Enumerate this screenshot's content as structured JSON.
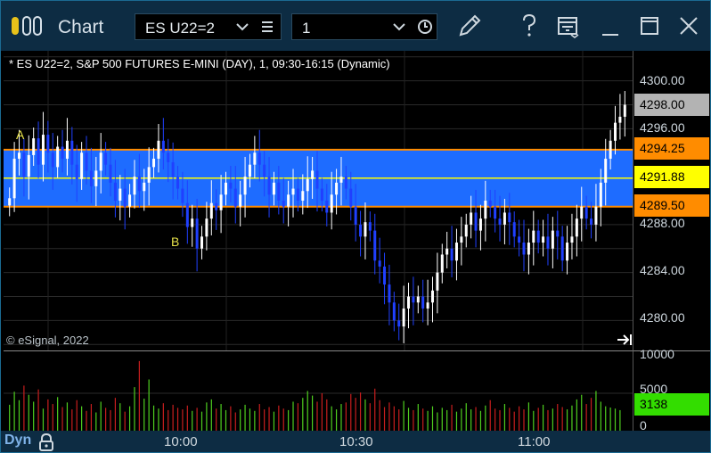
{
  "window": {
    "title": "Chart",
    "symbol": "ES U22=2",
    "interval": "1",
    "icons": [
      "app-logo-icon",
      "chevron-down-icon",
      "menu-lines-icon",
      "clock-icon",
      "pencil-icon",
      "help-icon",
      "toolbar-icon",
      "minimize-icon",
      "maximize-icon",
      "close-icon"
    ]
  },
  "study_label": "* ES U22=2, S&P 500 FUTURES E-MINI (DAY), 1, 09:30-16:15 (Dynamic)",
  "copyright": "© eSignal, 2022",
  "markers": {
    "a": "A",
    "b": "B"
  },
  "price_axis": {
    "ticks": [
      "4300.00",
      "4296.00",
      "4288.00",
      "4284.00",
      "4280.00"
    ],
    "tags": [
      {
        "label": "4298.00",
        "color": "#b3b3b3"
      },
      {
        "label": "4294.25",
        "color": "#ff8c00"
      },
      {
        "label": "4291.88",
        "color": "#ffff00"
      },
      {
        "label": "4289.50",
        "color": "#ff8c00"
      }
    ]
  },
  "volume_axis": {
    "ticks": [
      "10000",
      "5000",
      "0"
    ],
    "current": {
      "label": "3138",
      "color": "#33dd00"
    }
  },
  "time_axis": {
    "labels": [
      "10:00",
      "10:30",
      "11:00"
    ],
    "dyn_label": "Dyn"
  },
  "chart_data": {
    "type": "candlestick",
    "price_range": [
      4277.5,
      4302.5
    ],
    "volume_range": [
      0,
      10000
    ],
    "band": {
      "top": 4294.25,
      "bottom": 4289.5,
      "mid": 4291.88,
      "color": "#1e6cff"
    },
    "last_price": 4298.0,
    "last_volume": 3138,
    "closes": [
      4290.2,
      4293.5,
      4294.0,
      4292.0,
      4293.8,
      4295.2,
      4293.0,
      4295.5,
      4294.0,
      4292.8,
      4294.5,
      4293.5,
      4295.0,
      4293.0,
      4291.8,
      4294.0,
      4292.5,
      4291.2,
      4292.5,
      4294.0,
      4293.0,
      4291.5,
      4290.0,
      4291.0,
      4289.5,
      4290.5,
      4292.0,
      4290.8,
      4291.5,
      4292.8,
      4293.5,
      4295.0,
      4294.0,
      4293.2,
      4292.0,
      4291.0,
      4289.8,
      4287.8,
      4288.5,
      4286.0,
      4287.0,
      4288.5,
      4289.8,
      4289.2,
      4290.5,
      4291.5,
      4291.0,
      4289.5,
      4290.5,
      4292.0,
      4293.0,
      4294.0,
      4293.0,
      4292.0,
      4290.5,
      4291.5,
      4290.0,
      4289.5,
      4290.5,
      4291.0,
      4290.0,
      4290.8,
      4291.8,
      4292.5,
      4291.0,
      4290.0,
      4289.0,
      4290.5,
      4291.5,
      4292.0,
      4291.0,
      4289.5,
      4288.0,
      4287.0,
      4288.2,
      4287.5,
      4285.0,
      4284.5,
      4283.0,
      4281.5,
      4280.0,
      4279.5,
      4281.0,
      4282.0,
      4281.5,
      4282.0,
      4281.0,
      4281.5,
      4282.5,
      4284.0,
      4285.5,
      4286.0,
      4285.0,
      4286.5,
      4287.0,
      4288.0,
      4289.0,
      4287.5,
      4288.5,
      4290.0,
      4289.5,
      4288.5,
      4288.0,
      4289.0,
      4288.2,
      4287.0,
      4286.5,
      4285.5,
      4286.5,
      4287.5,
      4286.5,
      4287.0,
      4286.0,
      4287.5,
      4287.0,
      4285.0,
      4286.5,
      4287.0,
      4288.5,
      4289.5,
      4288.5,
      4288.0,
      4289.5,
      4291.5,
      4293.5,
      4295.0,
      4296.5,
      4297.0,
      4298.0
    ],
    "volumes": [
      3500,
      5200,
      4100,
      6000,
      4800,
      3900,
      5500,
      3000,
      4200,
      3600,
      4500,
      3200,
      3800,
      2900,
      4100,
      3300,
      2700,
      3600,
      2500,
      3900,
      3100,
      2800,
      4400,
      3700,
      2600,
      3300,
      5800,
      9200,
      4300,
      6800,
      3400,
      3000,
      3700,
      2800,
      3500,
      3100,
      2900,
      3400,
      2700,
      3100,
      2600,
      3800,
      4200,
      3000,
      3600,
      2800,
      3300,
      2500,
      2900,
      3500,
      3000,
      2700,
      3600,
      2900,
      3200,
      2600,
      3400,
      3000,
      2800,
      3900,
      3700,
      4400,
      5300,
      4700,
      3900,
      5000,
      4200,
      3300,
      2900,
      3600,
      3800,
      4900,
      4400,
      5100,
      4200,
      3700,
      5600,
      4100,
      3200,
      3800,
      3300,
      2900,
      4000,
      3100,
      2800,
      3600,
      3000,
      2700,
      3300,
      2500,
      3100,
      2800,
      3500,
      2600,
      3000,
      3700,
      2900,
      3200,
      2700,
      3400,
      4100,
      3000,
      2800,
      3600,
      3100,
      2600,
      3300,
      2900,
      3800,
      2700,
      3100,
      3500,
      2800,
      3000,
      3600,
      3200,
      2900,
      3400,
      4200,
      4800,
      3600,
      4400,
      5300,
      3900,
      3300,
      3138,
      3000,
      2800
    ]
  }
}
